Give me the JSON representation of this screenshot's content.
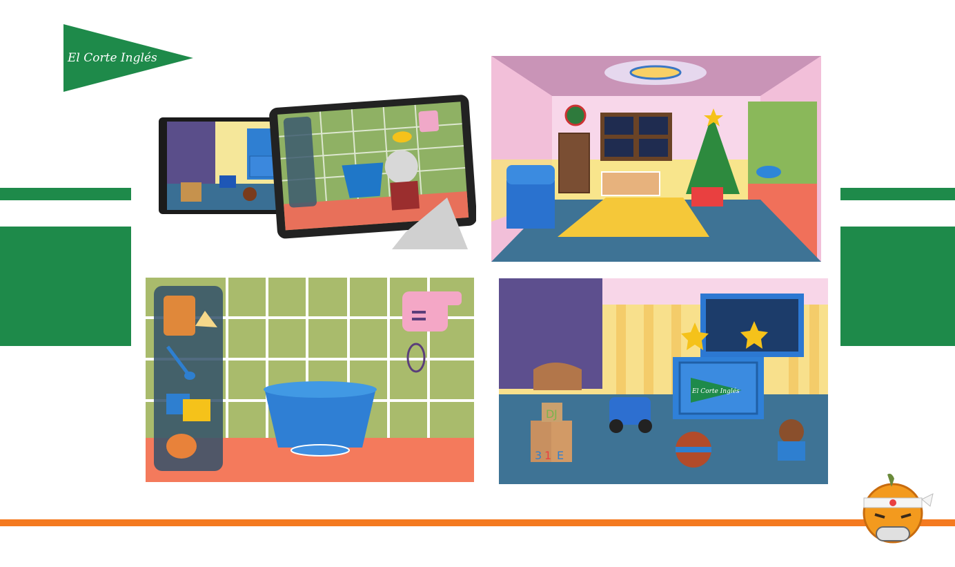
{
  "brand": {
    "logo_text": "El Corte Inglés",
    "logo_color": "#1e8a4a"
  },
  "colors": {
    "brand_green": "#1e8a4a",
    "accent_orange": "#f47a20",
    "background": "#ffffff"
  },
  "panels": {
    "devices": {
      "icon": "tablet-devices-screenshot"
    },
    "room": {
      "icon": "christmas-room-scene"
    },
    "kitchen": {
      "icon": "kitchen-baking-scene"
    },
    "toys": {
      "icon": "toy-box-scene",
      "blocks_letters": [
        "D",
        "J",
        "3",
        "1",
        "E"
      ],
      "chest_logo_text": "El Corte Inglés"
    }
  },
  "mascot": {
    "icon": "orange-gamer-mascot-icon"
  }
}
